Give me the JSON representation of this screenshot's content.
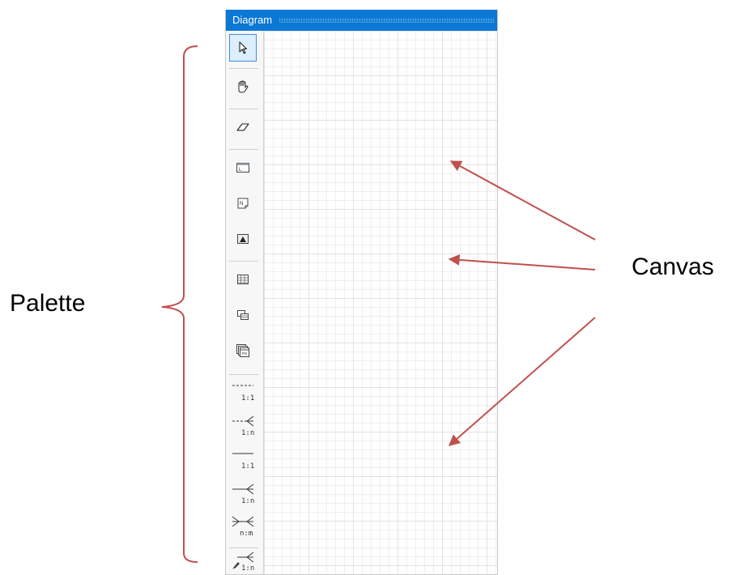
{
  "window": {
    "title": "Diagram"
  },
  "palette": {
    "tools": [
      {
        "name": "pointer",
        "icon": "pointer-icon",
        "selected": true
      },
      {
        "name": "hand",
        "icon": "hand-icon"
      },
      {
        "name": "eraser",
        "icon": "eraser-icon"
      },
      {
        "name": "label",
        "icon": "label-icon"
      },
      {
        "name": "note",
        "icon": "note-icon"
      },
      {
        "name": "image",
        "icon": "image-icon"
      },
      {
        "name": "table",
        "icon": "table-icon"
      },
      {
        "name": "view",
        "icon": "view-icon"
      },
      {
        "name": "procedure",
        "icon": "procedure-icon"
      }
    ],
    "relationships": [
      {
        "label": "1:1",
        "style": "dashed"
      },
      {
        "label": "1:n",
        "style": "dashed-crowfoot"
      },
      {
        "label": "1:1",
        "style": "solid"
      },
      {
        "label": "1:n",
        "style": "solid-crowfoot"
      },
      {
        "label": "n:m",
        "style": "solid-both-crowfoot"
      },
      {
        "label": "1:n",
        "style": "pencil-crowfoot"
      }
    ]
  },
  "annotations": {
    "palette_label": "Palette",
    "canvas_label": "Canvas",
    "arrow_color": "#c0504d"
  }
}
